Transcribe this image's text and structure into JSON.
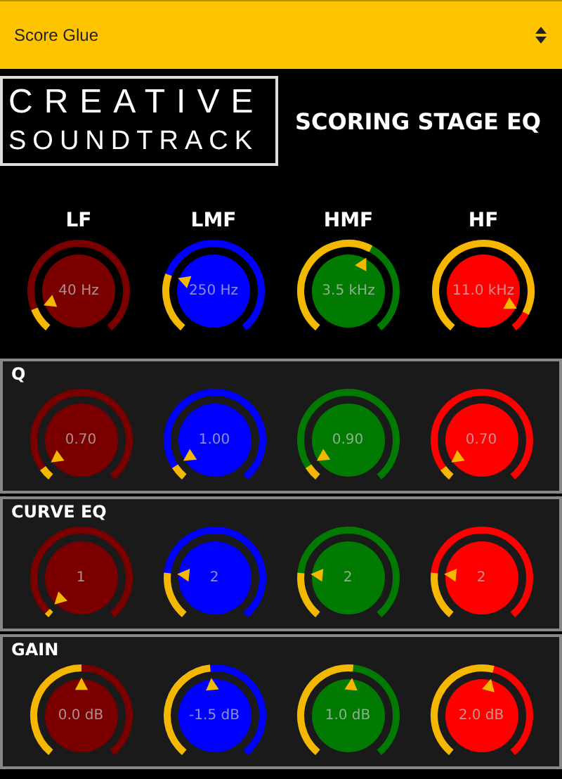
{
  "preset_select": {
    "value": "Score Glue"
  },
  "logo": {
    "line_1": "CREATIVE",
    "line_2": "SOUNDTRACK"
  },
  "title": "SCORING STAGE EQ",
  "bands": [
    {
      "label": "LF"
    },
    {
      "label": "LMF"
    },
    {
      "label": "HMF"
    },
    {
      "label": "HF"
    }
  ],
  "frequency_knobs": [
    {
      "value": "40 Hz",
      "color": "#7a0000"
    },
    {
      "value": "250 Hz",
      "color": "#0000ff"
    },
    {
      "value": "3.5 kHz",
      "color": "#007a00"
    },
    {
      "value": "11.0 kHz",
      "color": "#ff0000"
    }
  ],
  "sections": [
    {
      "title": "Q",
      "knobs": [
        {
          "value": "0.70",
          "color": "#7a0000"
        },
        {
          "value": "1.00",
          "color": "#0000ff"
        },
        {
          "value": "0.90",
          "color": "#007a00"
        },
        {
          "value": "0.70",
          "color": "#ff0000"
        }
      ]
    },
    {
      "title": "CURVE EQ",
      "knobs": [
        {
          "value": "1",
          "color": "#7a0000"
        },
        {
          "value": "2",
          "color": "#0000ff"
        },
        {
          "value": "2",
          "color": "#007a00"
        },
        {
          "value": "2",
          "color": "#ff0000"
        }
      ]
    },
    {
      "title": "GAIN",
      "knobs": [
        {
          "value": "0.0 dB",
          "color": "#7a0000"
        },
        {
          "value": "-1.5 dB",
          "color": "#0000ff"
        },
        {
          "value": "1.0 dB",
          "color": "#007a00"
        },
        {
          "value": "2.0 dB",
          "color": "#ff0000"
        }
      ]
    }
  ]
}
